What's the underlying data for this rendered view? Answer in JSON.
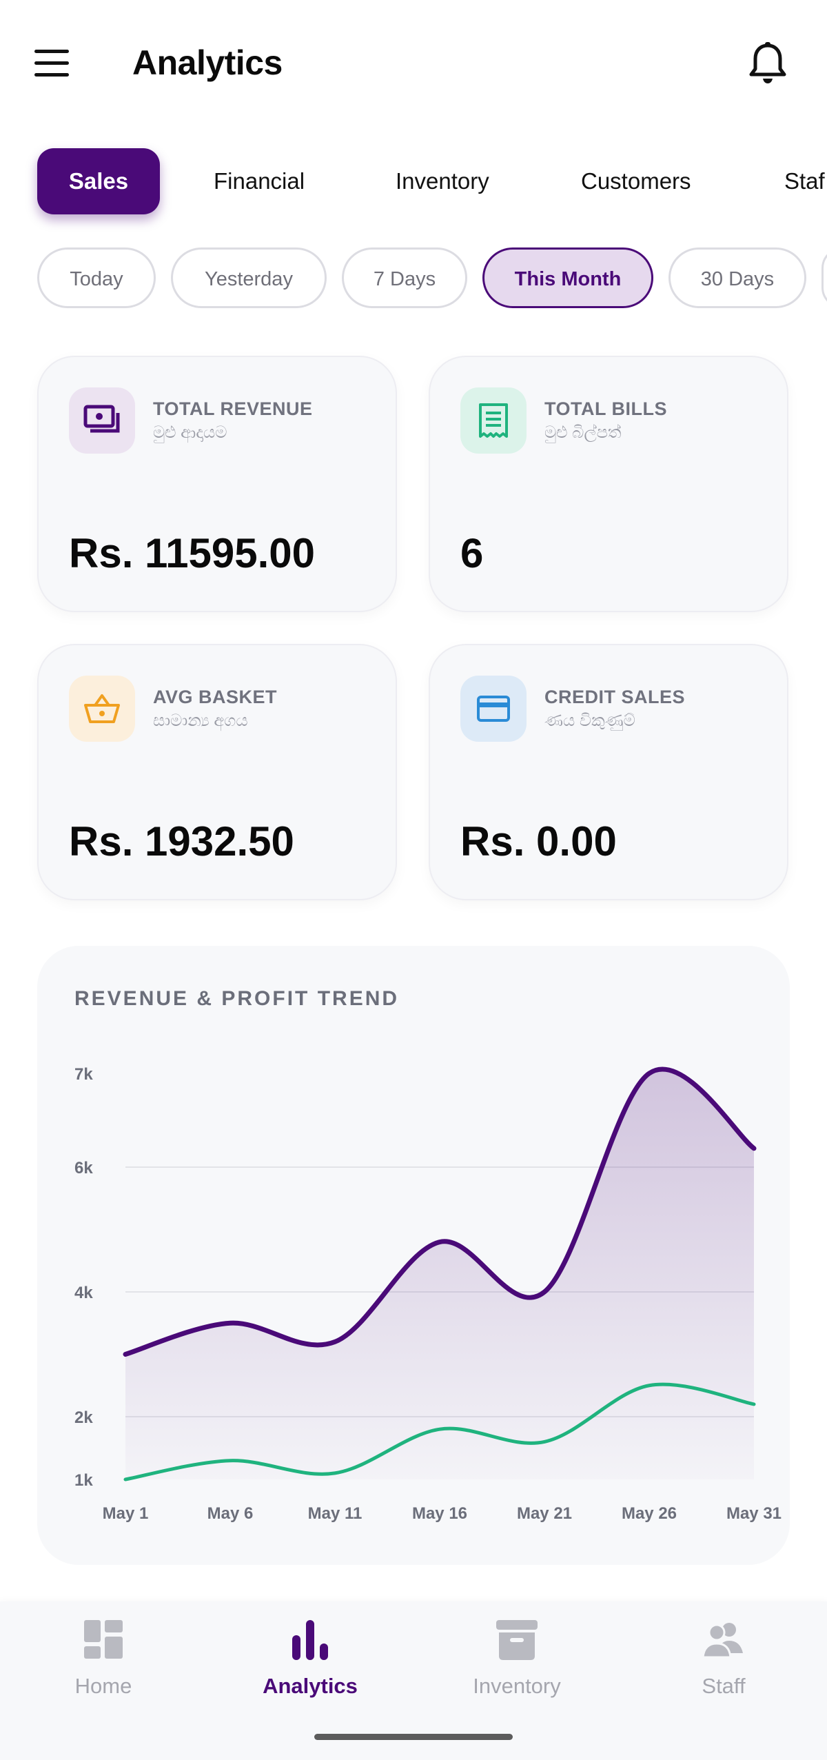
{
  "app_bar": {
    "title": "Analytics",
    "menu_icon": "hamburger-icon",
    "notify_icon": "bell-icon"
  },
  "tabs": [
    {
      "label": "Sales",
      "active": true
    },
    {
      "label": "Financial",
      "active": false
    },
    {
      "label": "Inventory",
      "active": false
    },
    {
      "label": "Customers",
      "active": false
    },
    {
      "label": "Staf",
      "active": false
    }
  ],
  "ranges": [
    {
      "label": "Today",
      "active": false
    },
    {
      "label": "Yesterday",
      "active": false
    },
    {
      "label": "7 Days",
      "active": false
    },
    {
      "label": "This Month",
      "active": true
    },
    {
      "label": "30 Days",
      "active": false
    }
  ],
  "stats": [
    {
      "label": "TOTAL REVENUE",
      "sub": "මුළු ආදායම",
      "value": "Rs. 11595.00",
      "icon": "cash-icon",
      "color": "#4a0a78",
      "bg": "#ece3f1"
    },
    {
      "label": "TOTAL BILLS",
      "sub": "මුළු බිල්පත්",
      "value": "6",
      "icon": "receipt-icon",
      "color": "#1fb37e",
      "bg": "#dcf3ea"
    },
    {
      "label": "AVG BASKET",
      "sub": "සාමාන්‍ය අගය",
      "value": "Rs. 1932.50",
      "icon": "basket-icon",
      "color": "#f0a020",
      "bg": "#fcefdc"
    },
    {
      "label": "CREDIT SALES",
      "sub": "ණය විකුණුම්",
      "value": "Rs. 0.00",
      "icon": "credit-card-icon",
      "color": "#2a8bd6",
      "bg": "#ddeaf7"
    }
  ],
  "chart_data": {
    "type": "area",
    "title": "REVENUE & PROFIT TREND",
    "x": [
      "May 1",
      "May 6",
      "May 11",
      "May 16",
      "May 21",
      "May 26",
      "May 31"
    ],
    "y_ticks": [
      "1k",
      "2k",
      "4k",
      "6k",
      "7k"
    ],
    "grid": true,
    "series": [
      {
        "color": "#4a0a78",
        "fill": true,
        "values": [
          3000,
          3500,
          3200,
          4800,
          4000,
          7000,
          6200
        ]
      },
      {
        "color": "#1fb37e",
        "fill": false,
        "values": [
          1000,
          1300,
          1100,
          1800,
          1600,
          2500,
          2200
        ]
      }
    ]
  },
  "bottom_nav": [
    {
      "label": "Home",
      "icon": "dashboard-icon",
      "active": false
    },
    {
      "label": "Analytics",
      "icon": "bar-chart-icon",
      "active": true
    },
    {
      "label": "Inventory",
      "icon": "archive-box-icon",
      "active": false
    },
    {
      "label": "Staff",
      "icon": "people-icon",
      "active": false
    }
  ]
}
